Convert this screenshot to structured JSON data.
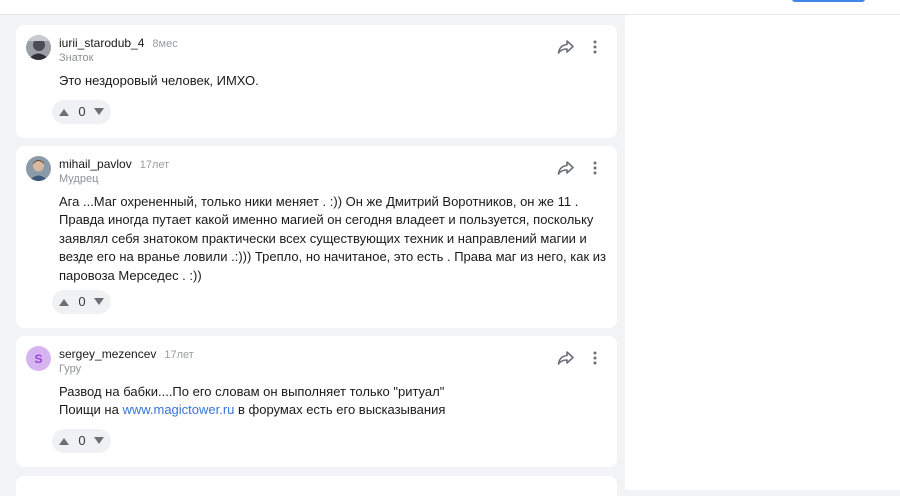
{
  "comments": [
    {
      "username": "iurii_starodub_4",
      "age": "8мес",
      "rank": "Знаток",
      "text": [
        "Это нездоровый человек, ИМХО."
      ],
      "votes": "0",
      "avatar": "photo-avatar"
    },
    {
      "username": "mihail_pavlov",
      "age": "17лет",
      "rank": "Мудрец",
      "text": [
        "Ага ...Маг охрененный, только ники меняет . :)) Он же Дмитрий Воротников, он же 11 . Правда иногда путает какой именно магией он сегодня владеет и пользуется, поскольку заявлял себя знатоком практически всех существующих техник и направлений магии и везде его на вранье ловили .:))) Трепло, но начитаное, это есть . Права маг из него, как из паровоза Мерседес . :))"
      ],
      "votes": "0",
      "avatar": "photo-avatar"
    },
    {
      "username": "sergey_mezencev",
      "age": "17лет",
      "rank": "Гуру",
      "avatar_letter": "S",
      "line1": "Развод на бабки....По его словам он выполняет только \"ритуал\"",
      "line2_before": "Поищи на ",
      "line2_link": "www.magictower.ru",
      "line2_after": " в форумах есть его высказывания",
      "votes": "0"
    }
  ],
  "colors": {
    "link": "#3775d6",
    "avatar_letter_bg": "#d6b4f0",
    "avatar_letter_fg": "#9a46d6",
    "icon": "#6b6f76"
  }
}
